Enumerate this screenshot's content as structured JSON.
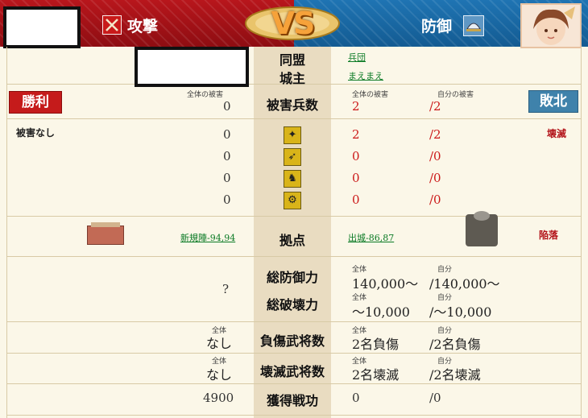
{
  "header": {
    "attacker_label": "攻撃",
    "vs": "VS",
    "defender_label": "防御",
    "icons": {
      "attacker": "crossed-swords-icon",
      "defender": "helmet-icon",
      "avatar": "general-portrait"
    }
  },
  "colors": {
    "attack": "#a4121a",
    "defense": "#1a69a6",
    "win": "#c51b1b",
    "lose": "#3f82ab",
    "red_text": "#cc1a1a",
    "link": "#0a7a24"
  },
  "rows": {
    "alliance": {
      "label": "同盟",
      "defender_value": "兵団"
    },
    "lord": {
      "label": "城主",
      "defender_value": "まえまえ"
    },
    "damage": {
      "label": "被害兵数",
      "attacker_caption": "全体の被害",
      "attacker_value": "0",
      "def_total_caption": "全体の被害",
      "def_total_value": "2",
      "def_own_caption": "自分の被害",
      "def_own_value": "/2"
    },
    "units": {
      "attacker_note": "被害なし",
      "defender_note": "壊滅",
      "items": [
        {
          "icon": "spearman-icon",
          "attacker": "0",
          "def_total": "2",
          "def_own": "/2"
        },
        {
          "icon": "bow-icon",
          "attacker": "0",
          "def_total": "0",
          "def_own": "/0"
        },
        {
          "icon": "horse-icon",
          "attacker": "0",
          "def_total": "0",
          "def_own": "/0"
        },
        {
          "icon": "siege-icon",
          "attacker": "0",
          "def_total": "0",
          "def_own": "/0"
        }
      ]
    },
    "base": {
      "label": "拠点",
      "attacker_link": "新規陣-94,94",
      "defender_link": "出城-86,87",
      "defender_status": "陥落"
    },
    "defense_power": {
      "label": "総防御力",
      "attacker_value": "?",
      "total_caption": "全体",
      "total_value": "140,000〜",
      "own_caption": "自分",
      "own_value": "/140,000〜"
    },
    "destroy_power": {
      "label": "総破壊力",
      "total_caption": "全体",
      "total_value": "〜10,000",
      "own_caption": "自分",
      "own_value": "/〜10,000"
    },
    "injured": {
      "label": "負傷武将数",
      "attacker_caption": "全体",
      "attacker_value": "なし",
      "total_caption": "全体",
      "total_value": "2名負傷",
      "own_caption": "自分",
      "own_value": "/2名負傷"
    },
    "destroyed": {
      "label": "壊滅武将数",
      "attacker_caption": "全体",
      "attacker_value": "なし",
      "total_caption": "全体",
      "total_value": "2名壊滅",
      "own_caption": "自分",
      "own_value": "/2名壊滅"
    },
    "merit": {
      "label": "獲得戦功",
      "attacker_value": "4900",
      "total_value": "0",
      "own_value": "/0"
    }
  },
  "badges": {
    "win": "勝利",
    "lose": "敗北"
  }
}
